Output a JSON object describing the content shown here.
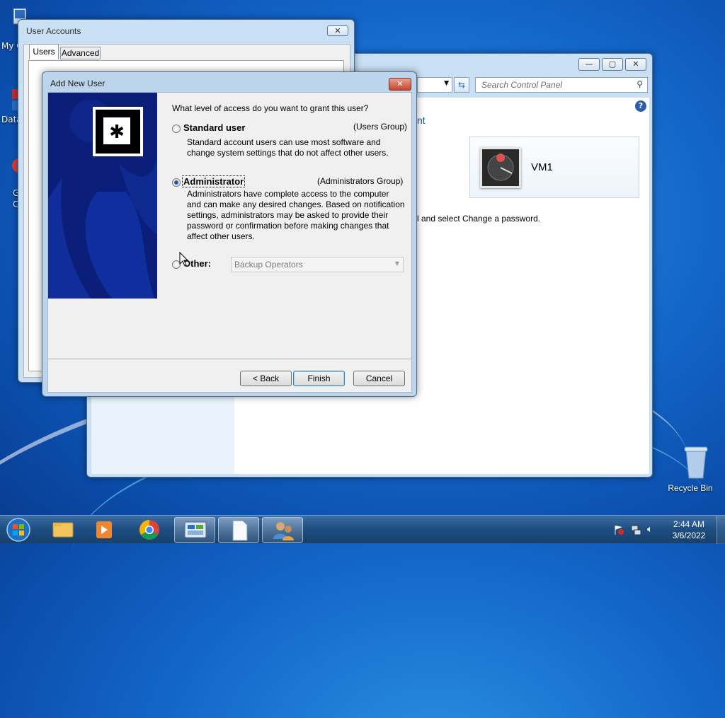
{
  "desktop": {
    "icons": [
      {
        "label": "My C"
      },
      {
        "label": "Data"
      },
      {
        "label": "G"
      },
      {
        "label": "C"
      },
      {
        "label": "Recycle Bin"
      }
    ]
  },
  "user_accounts": {
    "title": "User Accounts",
    "tabs": [
      "Users",
      "Advanced"
    ],
    "close": "✕"
  },
  "control_panel": {
    "search_placeholder": "Search Control Panel",
    "link_partial": "nt",
    "user_name": "VM1",
    "hint_text": "l and select Change a password.",
    "buttons": {
      "minimize": "—",
      "maximize": "▢",
      "close": "✕"
    }
  },
  "dialog": {
    "title": "Add New User",
    "close": "✕",
    "question": "What level of access do you want to grant this user?",
    "options": [
      {
        "label": "Standard user",
        "group": "(Users Group)",
        "selected": false,
        "description": [
          "Standard account users can use most software and",
          "change system settings that do not affect other users."
        ]
      },
      {
        "label": "Administrator",
        "group": "(Administrators Group)",
        "selected": true,
        "description": [
          "Administrators have complete access to the computer",
          "and can make any desired changes. Based on notification",
          "settings, administrators may be asked to provide their",
          "password or confirmation before making changes that",
          "affect other users."
        ]
      },
      {
        "label": "Other:",
        "selected": false
      }
    ],
    "other_select_value": "Backup Operators",
    "buttons": {
      "back": "< Back",
      "finish": "Finish",
      "cancel": "Cancel"
    }
  },
  "taskbar": {
    "time": "2:44 AM",
    "date": "3/6/2022",
    "items": [
      "start-orb",
      "file-explorer",
      "media-player",
      "chrome",
      "control-panel",
      "notepad",
      "user-accounts"
    ]
  },
  "colors": {
    "accent": "#1e5da8",
    "desktop_blue": "#1366c9",
    "dialog_banner": "#0b1f7a"
  }
}
